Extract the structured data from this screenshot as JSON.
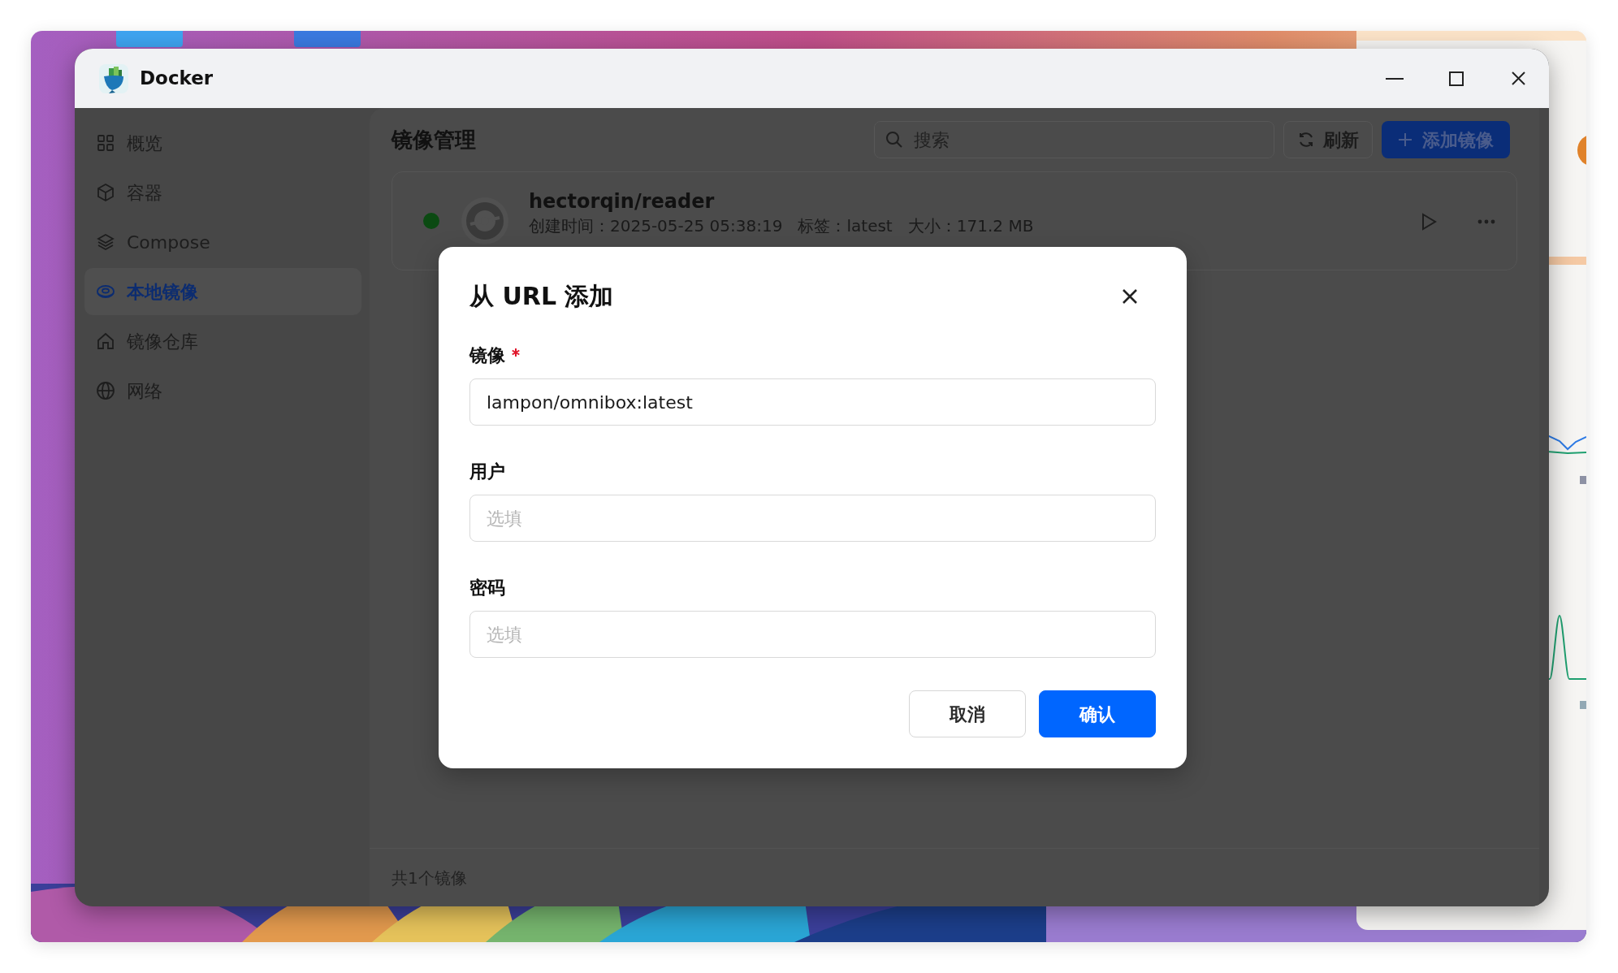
{
  "window": {
    "title": "Docker"
  },
  "sidebar": {
    "items": [
      {
        "label": "概览",
        "selected": false
      },
      {
        "label": "容器",
        "selected": false
      },
      {
        "label": "Compose",
        "selected": false
      },
      {
        "label": "本地镜像",
        "selected": true
      },
      {
        "label": "镜像仓库",
        "selected": false
      },
      {
        "label": "网络",
        "selected": false
      }
    ]
  },
  "page": {
    "title": "镜像管理",
    "search": {
      "placeholder": "搜索"
    },
    "refresh_button": "刷新",
    "add_button": "添加镜像"
  },
  "images": [
    {
      "name": "hectorqin/reader",
      "running": true,
      "details": "创建时间：2025-05-25 05:38:19   标签：latest   大小：171.2 MB"
    }
  ],
  "footer": "共1个镜像",
  "dialog": {
    "title": "从 URL 添加",
    "fields": [
      {
        "label": "镜像",
        "required": true,
        "value": "lampon/omnibox:latest"
      },
      {
        "label": "用户",
        "required": false,
        "placeholder": "选填"
      },
      {
        "label": "密码",
        "required": false,
        "placeholder": "选填"
      }
    ],
    "buttons": [
      {
        "label": "取消",
        "kind": "secondary"
      },
      {
        "label": "确认",
        "kind": "primary"
      }
    ]
  }
}
